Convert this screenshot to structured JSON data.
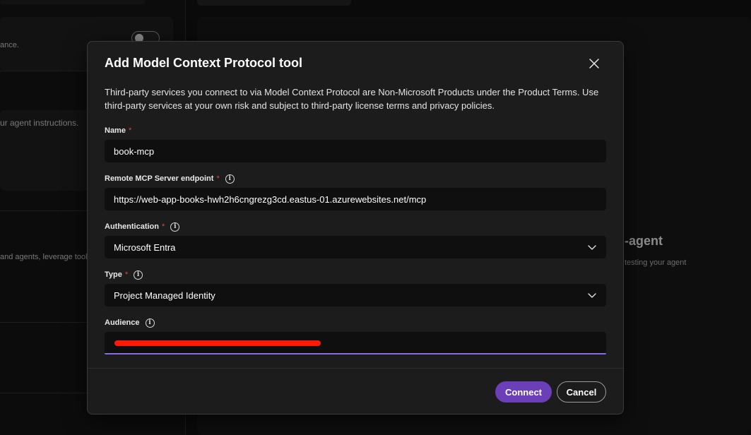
{
  "background": {
    "left_text_1": "ance.",
    "left_text_2": "ur agent instructions.",
    "left_text_3": "and agents, leverage tools",
    "heading_fragment": "-agent",
    "subtext_fragment": "testing your agent"
  },
  "dialog": {
    "title": "Add Model Context Protocol tool",
    "notice": "Third-party services you connect to via Model Context Protocol are Non-Microsoft Products under the Product Terms. Use third-party services at your own risk and subject to third-party license terms and privacy policies.",
    "fields": {
      "name": {
        "label": "Name",
        "required_marker": "*",
        "value": "book-mcp"
      },
      "endpoint": {
        "label": "Remote MCP Server endpoint",
        "required_marker": "*",
        "value": "https://web-app-books-hwh2h6cngrezg3cd.eastus-01.azurewebsites.net/mcp"
      },
      "authentication": {
        "label": "Authentication",
        "required_marker": "*",
        "value": "Microsoft Entra"
      },
      "type": {
        "label": "Type",
        "required_marker": "*",
        "value": "Project Managed Identity"
      },
      "audience": {
        "label": "Audience",
        "value": ""
      }
    },
    "buttons": {
      "connect": "Connect",
      "cancel": "Cancel"
    },
    "icons": {
      "close": "close-icon",
      "info": "info-icon",
      "chevron": "chevron-down-icon"
    },
    "colors": {
      "accent": "#6b3fb8",
      "focus_border": "#8a6be0",
      "required": "#e0454a",
      "redaction": "#ff1a05"
    }
  }
}
